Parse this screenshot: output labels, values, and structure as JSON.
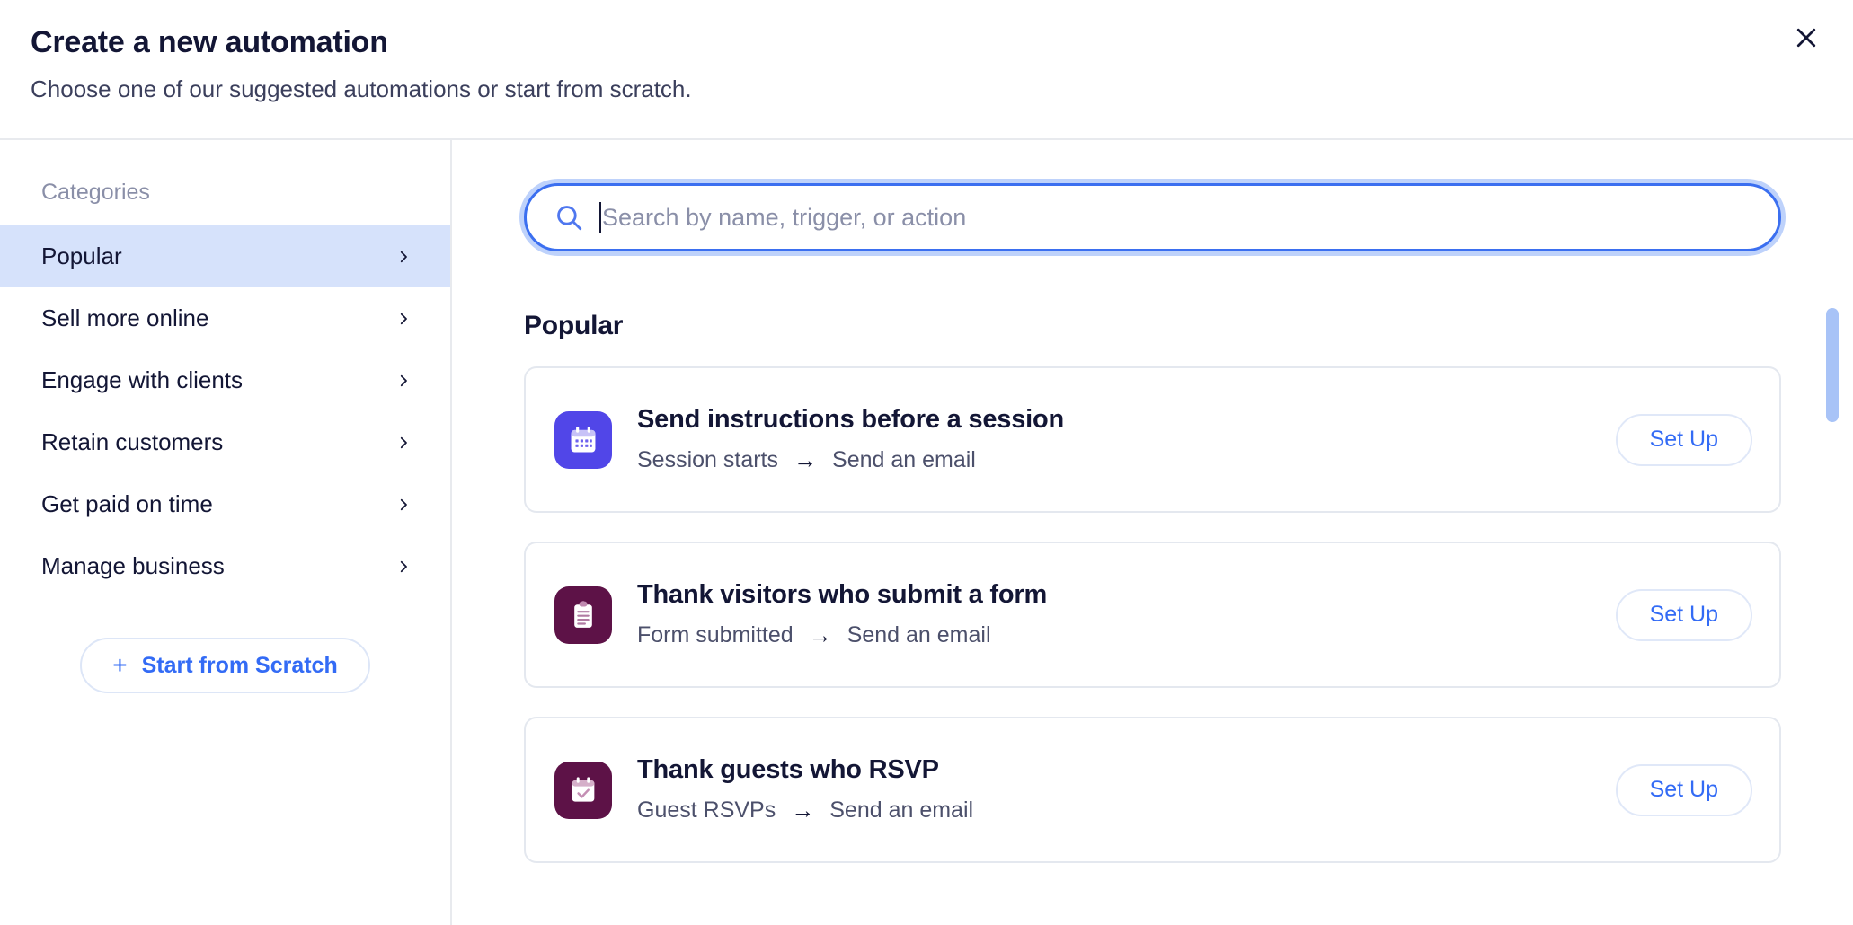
{
  "header": {
    "title": "Create a new automation",
    "subtitle": "Choose one of our suggested automations or start from scratch.",
    "close_label": "close-icon"
  },
  "sidebar": {
    "heading": "Categories",
    "items": [
      {
        "label": "Popular",
        "active": true
      },
      {
        "label": "Sell more online",
        "active": false
      },
      {
        "label": "Engage with clients",
        "active": false
      },
      {
        "label": "Retain customers",
        "active": false
      },
      {
        "label": "Get paid on time",
        "active": false
      },
      {
        "label": "Manage business",
        "active": false
      }
    ],
    "scratch_button": {
      "plus": "+",
      "label": "Start from Scratch"
    }
  },
  "search": {
    "placeholder": "Search by name, trigger, or action",
    "value": "",
    "icon": "search-icon",
    "focused": true
  },
  "main": {
    "section_title": "Popular",
    "cards": [
      {
        "title": "Send instructions before a session",
        "trigger": "Session starts",
        "arrow": "→",
        "action": "Send an email",
        "button": "Set Up",
        "icon": "calendar-icon",
        "icon_bg": "#5146e8"
      },
      {
        "title": "Thank visitors who submit a form",
        "trigger": "Form submitted",
        "arrow": "→",
        "action": "Send an email",
        "button": "Set Up",
        "icon": "clipboard-icon",
        "icon_bg": "#5d1247"
      },
      {
        "title": "Thank guests who RSVP",
        "trigger": "Guest RSVPs",
        "arrow": "→",
        "action": "Send an email",
        "button": "Set Up",
        "icon": "calendar-check-icon",
        "icon_bg": "#5d1247"
      }
    ]
  },
  "colors": {
    "accent_blue": "#336bf5",
    "focus_border": "#3b6ff0",
    "focus_halo": "#bed2fb",
    "active_row": "#d6e2fb",
    "text_primary": "#131635",
    "text_muted": "#8a8fa8",
    "border": "#e8eaee",
    "scrollbar_thumb": "#a8c3f7"
  }
}
